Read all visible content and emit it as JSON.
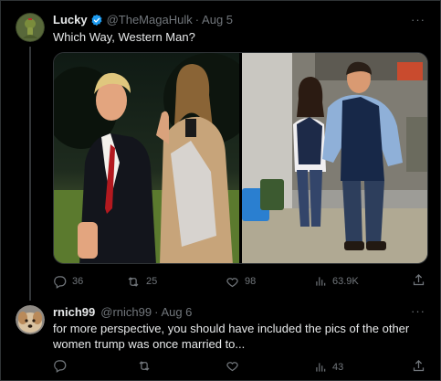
{
  "tweet1": {
    "display_name": "Lucky",
    "handle": "@TheMagaHulk",
    "date": "Aug 5",
    "text": "Which Way, Western Man?",
    "stats": {
      "replies": "36",
      "retweets": "25",
      "likes": "98",
      "views": "63.9K"
    }
  },
  "tweet2": {
    "display_name": "rnich99",
    "handle": "@rnich99",
    "date": "Aug 6",
    "text_line1": "for more perspective, you should have included the pics of the other",
    "text_line2": "women trump was once married to...",
    "stats": {
      "views": "43"
    }
  },
  "colors": {
    "background": "#000000",
    "text": "#e7e9ea",
    "muted": "#71767b",
    "verified": "#1d9bf0",
    "border": "#2f3336"
  },
  "icons": [
    "more-icon",
    "verified-badge-icon",
    "reply-icon",
    "retweet-icon",
    "like-icon",
    "views-icon",
    "share-icon"
  ]
}
